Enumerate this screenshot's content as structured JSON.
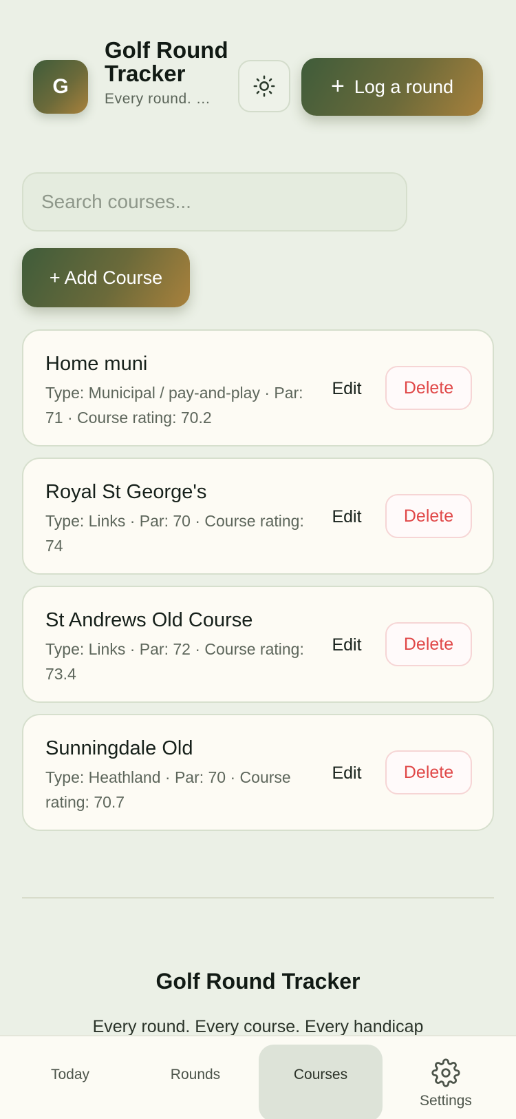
{
  "header": {
    "logo_letter": "G",
    "app_title": "Golf Round Tracker",
    "tagline": "Every round. Every course. Every handicap",
    "theme_icon": "sun-icon",
    "log_button_label": "Log a round",
    "log_button_icon": "plus-icon"
  },
  "search": {
    "placeholder": "Search courses..."
  },
  "add_course_label": "+ Add Course",
  "courses": [
    {
      "name": "Home muni",
      "meta": "Type: Municipal / pay-and-play · Par: 71 · Course rating: 70.2",
      "edit_label": "Edit",
      "delete_label": "Delete"
    },
    {
      "name": "Royal St George's",
      "meta": "Type: Links · Par: 70 · Course rating: 74",
      "edit_label": "Edit",
      "delete_label": "Delete"
    },
    {
      "name": "St Andrews Old Course",
      "meta": "Type: Links · Par: 72 · Course rating: 73.4",
      "edit_label": "Edit",
      "delete_label": "Delete"
    },
    {
      "name": "Sunningdale Old",
      "meta": "Type: Heathland · Par: 70 · Course rating: 70.7",
      "edit_label": "Edit",
      "delete_label": "Delete"
    }
  ],
  "footer": {
    "title": "Golf Round Tracker",
    "tagline": "Every round. Every course. Every handicap"
  },
  "nav": {
    "items": [
      {
        "label": "Today"
      },
      {
        "label": "Rounds"
      },
      {
        "label": "Courses",
        "active": true
      },
      {
        "label": "Settings",
        "icon": "gear-icon"
      }
    ]
  },
  "colors": {
    "background": "#ebf0e6",
    "accent_gradient_start": "#3f5c3a",
    "accent_gradient_end": "#a8813c",
    "delete_red": "#e04848",
    "card_background": "#fdfbf4"
  }
}
